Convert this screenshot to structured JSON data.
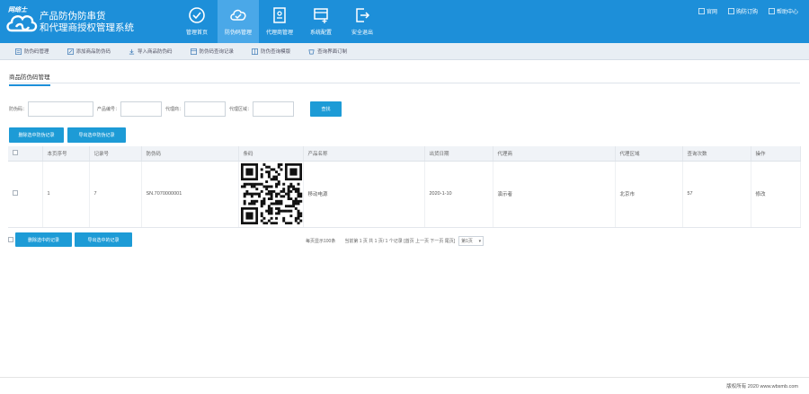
{
  "header": {
    "logo_text": "网络士",
    "brand_line1": "产品防伪防串货",
    "brand_line2": "和代理商授权管理系统",
    "nav": [
      {
        "label": "管理首页",
        "icon": "check-circle-icon"
      },
      {
        "label": "防伪码管理",
        "icon": "cloud-check-icon"
      },
      {
        "label": "代理商管理",
        "icon": "id-card-icon"
      },
      {
        "label": "系统配置",
        "icon": "app-add-icon"
      },
      {
        "label": "安全退出",
        "icon": "logout-icon"
      }
    ],
    "top_links": [
      {
        "label": "官网",
        "icon": "home-icon"
      },
      {
        "label": "购防订购",
        "icon": "cart-icon"
      },
      {
        "label": "帮助中心",
        "icon": "help-icon"
      }
    ]
  },
  "subnav": [
    {
      "label": "防伪码管理",
      "icon": "list-icon"
    },
    {
      "label": "添加商品防伪码",
      "icon": "edit-icon"
    },
    {
      "label": "导入商品防伪码",
      "icon": "import-icon"
    },
    {
      "label": "防伪码查询记录",
      "icon": "record-icon"
    },
    {
      "label": "防伪查询模版",
      "icon": "template-icon"
    },
    {
      "label": "查询界面订制",
      "icon": "custom-icon"
    }
  ],
  "section_title": "商品防伪码管理",
  "search": {
    "fields": [
      {
        "label": "防伪码：",
        "value": ""
      },
      {
        "label": "产品编号：",
        "value": ""
      },
      {
        "label": "代理商：",
        "value": ""
      },
      {
        "label": "代理区域：",
        "value": ""
      }
    ],
    "button": "查找"
  },
  "actions": {
    "delete_checked": "删除选中防伪记录",
    "export_checked": "导出选中防伪记录"
  },
  "table": {
    "headers": [
      "本页序号",
      "记录号",
      "防伪码",
      "条码",
      "产品名称",
      "出货日期",
      "代理商",
      "代理区域",
      "查询次数",
      "操作"
    ],
    "rows": [
      {
        "index": "1",
        "record": "7",
        "code": "SN.7070000001",
        "product": "移动电源",
        "date": "2020-1-10",
        "agent": "演示者",
        "region": "北京市",
        "count": "57",
        "action": "修改"
      }
    ]
  },
  "footer": {
    "delete_checked": "删除选中的记录",
    "export_checked": "导出选中的记录",
    "per_page": "每页显示100条",
    "pager_text": "当前第 1 页 共 1 页/ 1 个记录  [首页 上一页 下一页 尾页]",
    "page_select": "第1页"
  },
  "copyright": "版权所有 2020 www.wbsmb.com"
}
